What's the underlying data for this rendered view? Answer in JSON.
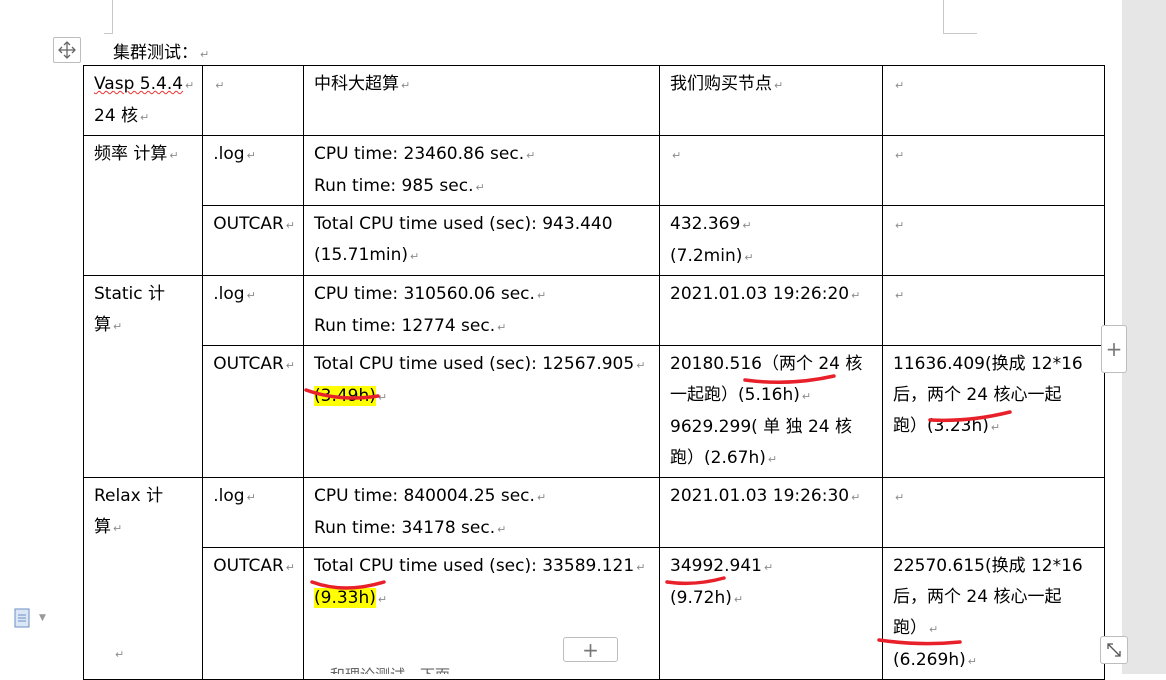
{
  "document": {
    "heading": "集群测试：",
    "paragraph_mark": "↵",
    "bottom_cutoff_text": "和理论测试，下面"
  },
  "table": {
    "header": {
      "c0_line1": "Vasp 5.4.4",
      "c0_line2": "24 核",
      "c2": "中科大超算",
      "c3": "我们购买节点"
    },
    "rows": [
      {
        "section": "频率 计算",
        "type": ".log",
        "c2_lines": [
          "CPU time: 23460.86 sec.",
          "Run time: 985 sec."
        ],
        "c3_lines": [],
        "c4_lines": []
      },
      {
        "section": "",
        "type": "OUTCAR",
        "c2_lines": [
          "Total  CPU  time  used  (sec):  943.440",
          "(15.71min)"
        ],
        "c3_lines": [
          "432.369",
          "(7.2min)"
        ],
        "c4_lines": []
      },
      {
        "section_line1": "Static   计",
        "section_line2": "算",
        "type": ".log",
        "c2_lines": [
          "CPU time: 310560.06 sec.",
          "Run time: 12774 sec."
        ],
        "c3_lines": [
          "2021.01.03  19:26:20"
        ],
        "c4_lines": []
      },
      {
        "section": "",
        "type": "OUTCAR",
        "c2_lines": [
          "Total CPU time used (sec): 12567.905",
          "(3.49h)"
        ],
        "c3_lines": [
          "20180.516（两个 24 核",
          "一起跑）(5.16h)",
          "9629.299( 单 独  24  核",
          "跑）(2.67h)"
        ],
        "c4_lines": [
          "11636.409(换成 12*16",
          "后，两个 24 核心一起",
          "跑）(3.23h)"
        ]
      },
      {
        "section_line1": "Relax   计",
        "section_line2": "算",
        "type": ".log",
        "c2_lines": [
          "CPU time: 840004.25 sec.",
          "Run time: 34178 sec."
        ],
        "c3_lines": [
          "2021.01.03  19:26:30"
        ],
        "c4_lines": []
      },
      {
        "section": "",
        "type": "OUTCAR",
        "c2_lines": [
          "Total CPU time used (sec): 33589.121",
          "(9.33h)"
        ],
        "c3_lines": [
          "34992.941",
          "(9.72h)"
        ],
        "c4_lines": [
          "22570.615(换成 12*16",
          "后，两个 24 核心一起",
          "跑）",
          "(6.269h)"
        ]
      }
    ]
  },
  "icons": {
    "move": "move-arrows-icon",
    "add_col": "plus-icon",
    "add_row": "plus-icon",
    "resize": "resize-diagonal-icon",
    "page": "page-icon"
  },
  "colors": {
    "highlight": "#ffff00",
    "annotation": "#e8202a"
  }
}
